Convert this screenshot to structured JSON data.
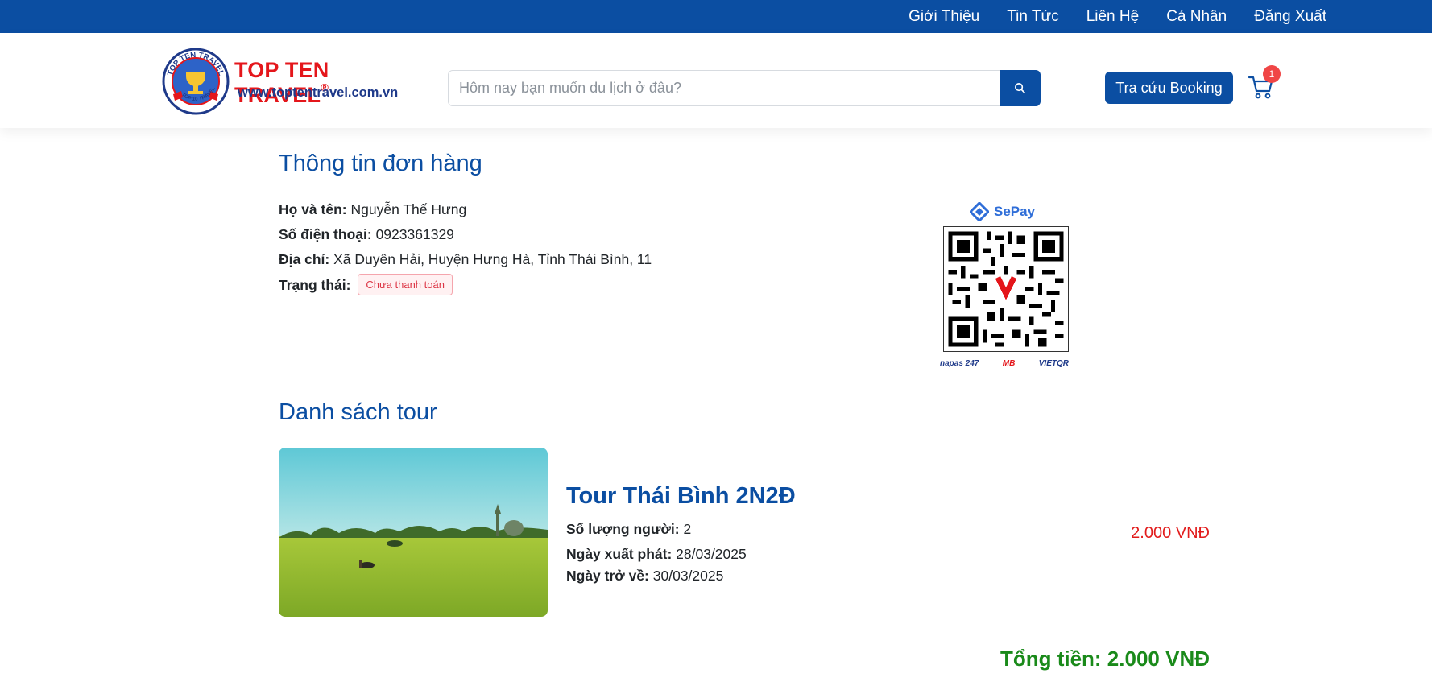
{
  "topnav": {
    "items": [
      "Giới Thiệu",
      "Tin Tức",
      "Liên Hệ",
      "Cá Nhân",
      "Đăng Xuất"
    ]
  },
  "header": {
    "logo_title": "TOP TEN TRAVEL",
    "logo_registered": "®",
    "logo_url": "www.toptentravel.com.vn",
    "logo_ring_top": "TOP TEN TRAVEL",
    "logo_ring_bottom": "TOP 10 TRAVEL",
    "search_placeholder": "Hôm nay bạn muốn du lịch ở đâu?",
    "lookup_label": "Tra cứu Booking",
    "cart_count": "1"
  },
  "order": {
    "heading": "Thông tin đơn hàng",
    "name_label": "Họ và tên:",
    "name_value": "Nguyễn Thế Hưng",
    "phone_label": "Số điện thoại:",
    "phone_value": "0923361329",
    "address_label": "Địa chỉ:",
    "address_value": "Xã Duyên Hải, Huyện Hưng Hà, Tỉnh Thái Bình, 11",
    "status_label": "Trạng thái:",
    "status_value": "Chưa thanh toán"
  },
  "payment": {
    "brand": "SePay",
    "footer": [
      "napas 247",
      "MB",
      "VIETQR"
    ]
  },
  "tours": {
    "heading": "Danh sách tour",
    "items": [
      {
        "title": "Tour Thái Bình 2N2Đ",
        "people_label": "Số lượng người:",
        "people_value": "2",
        "depart_label": "Ngày xuất phát:",
        "depart_value": "28/03/2025",
        "return_label": "Ngày trở về:",
        "return_value": "30/03/2025",
        "price": "2.000 VNĐ"
      }
    ],
    "total": "Tổng tiền: 2.000 VNĐ"
  },
  "colors": {
    "primary": "#0b4ea2",
    "price": "#e21b1b",
    "total": "#1a8a1a",
    "status": "#dc3545"
  }
}
